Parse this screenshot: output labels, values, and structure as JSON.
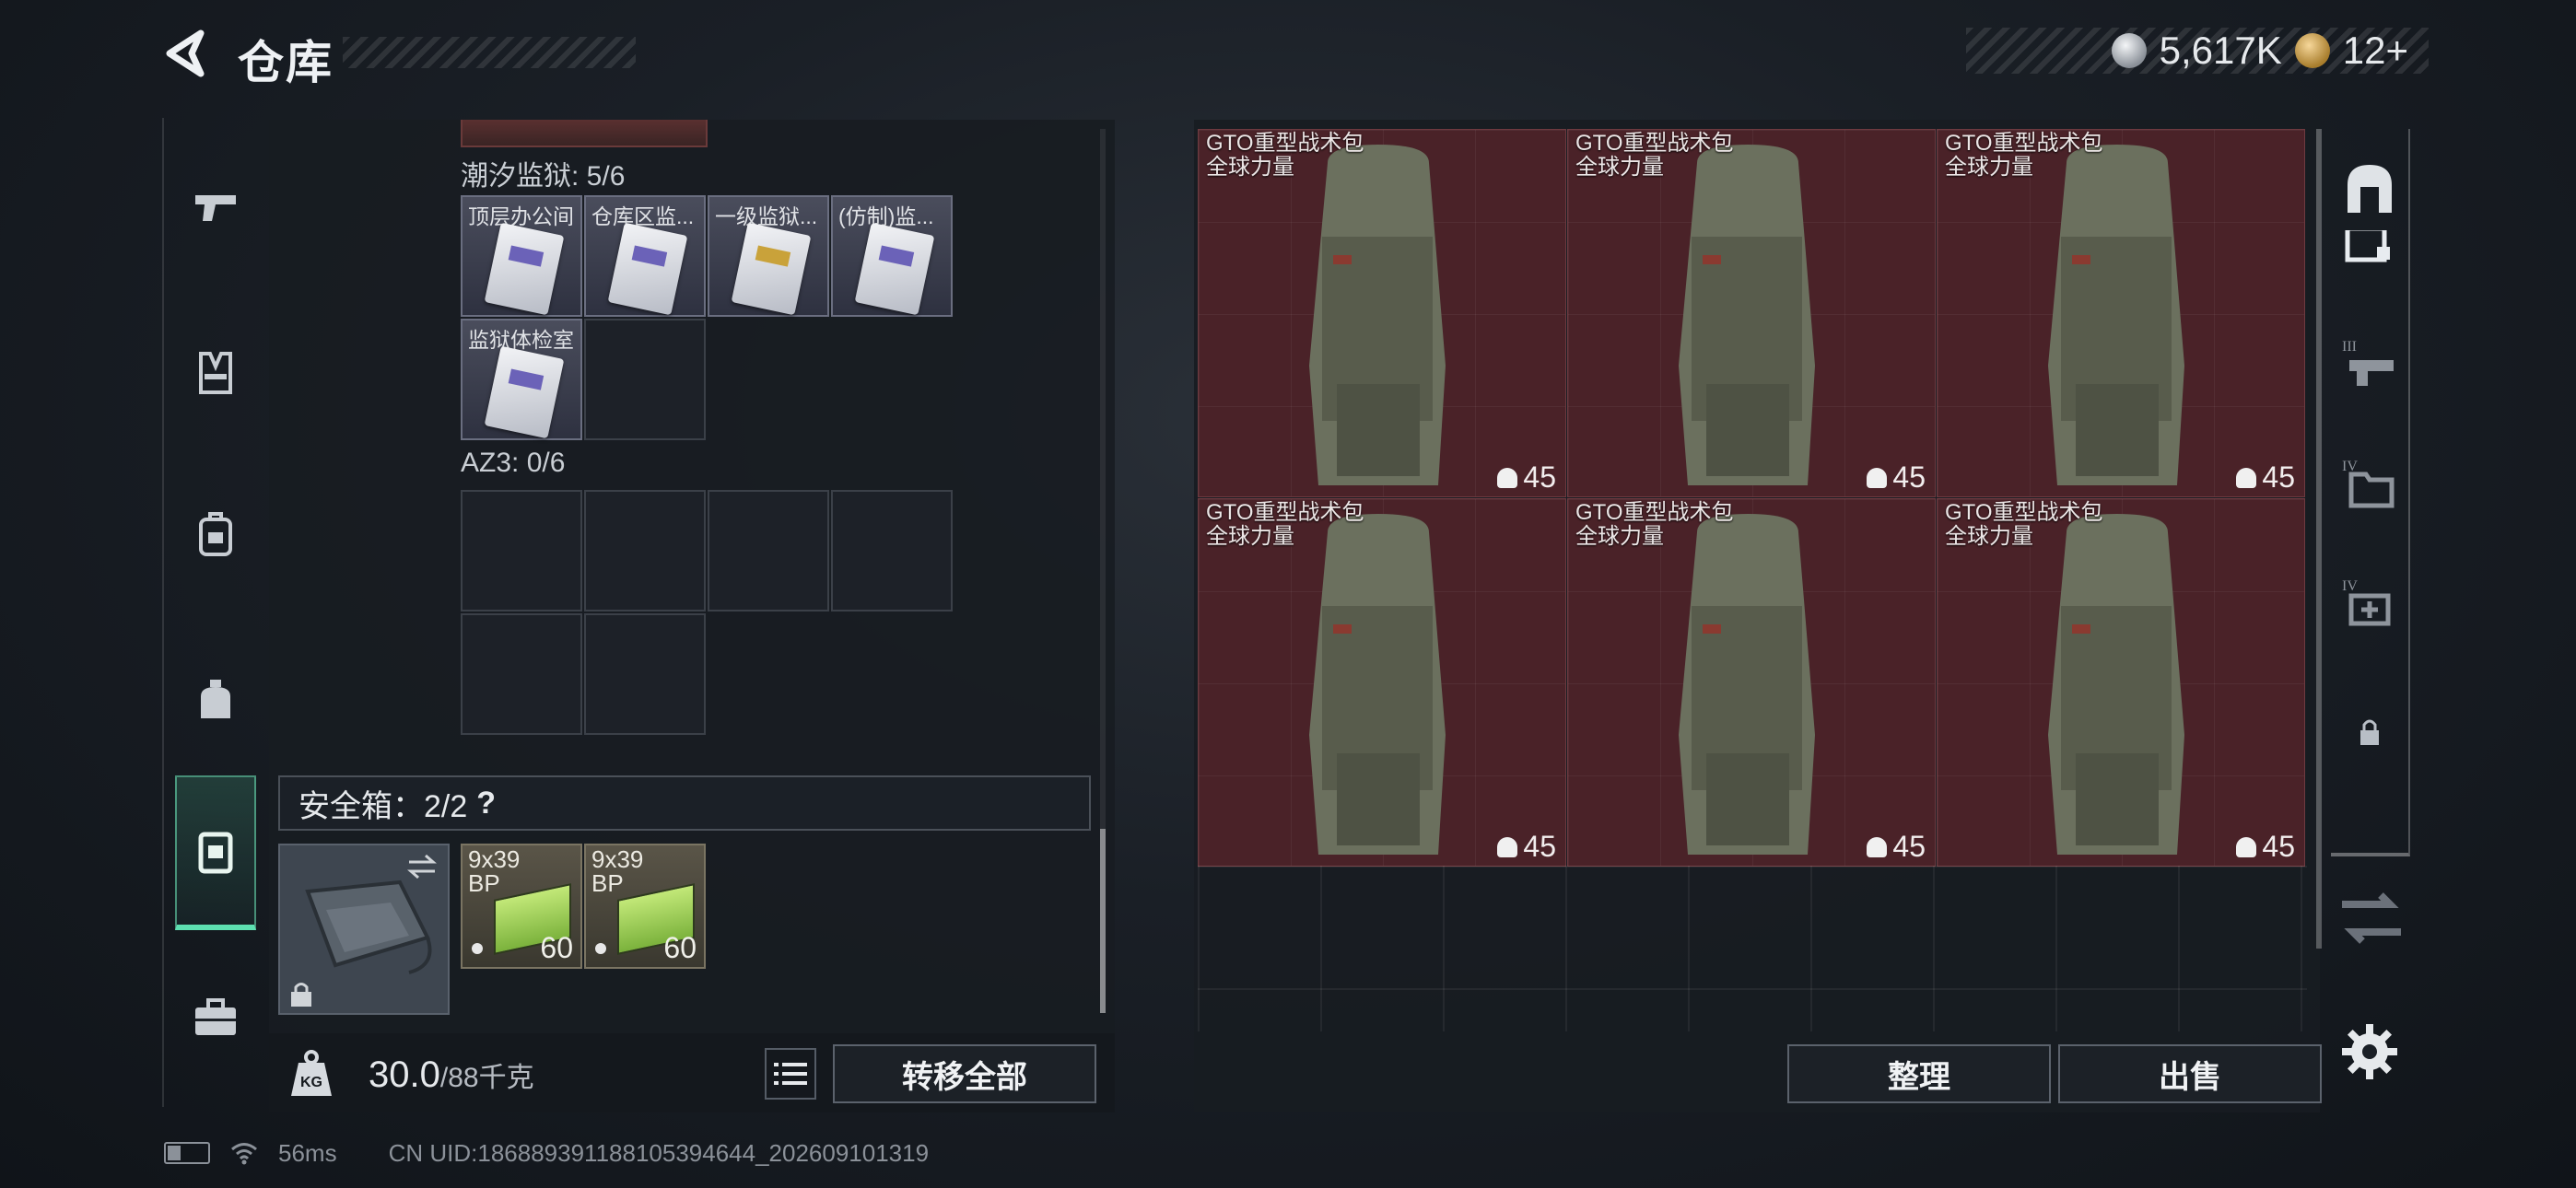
{
  "header": {
    "title": "仓库",
    "currency_silver": "5,617K",
    "currency_gold": "12+"
  },
  "left_panel": {
    "tidal_prison": {
      "title": "潮汐监狱: 5/6",
      "cards": [
        {
          "label": "顶层办公间",
          "variant": "silver"
        },
        {
          "label": "仓库区监...",
          "variant": "silver"
        },
        {
          "label": "一级监狱...",
          "variant": "gold"
        },
        {
          "label": "(仿制)监...",
          "variant": "silver"
        },
        {
          "label": "监狱体检室",
          "variant": "silver"
        }
      ]
    },
    "az3": {
      "title": "AZ3: 0/6"
    },
    "safe_box": {
      "title": "安全箱：2/2",
      "help": "?",
      "ammo": [
        {
          "label": "9x39\nBP",
          "count": "60"
        },
        {
          "label": "9x39\nBP",
          "count": "60"
        }
      ]
    },
    "weight": {
      "value": "30.0",
      "unit": "/88千克"
    },
    "transfer_all_label": "转移全部"
  },
  "right_panel": {
    "items": [
      {
        "name": "GTO重型战术包",
        "sub": "全球力量",
        "durability": "45"
      },
      {
        "name": "GTO重型战术包",
        "sub": "全球力量",
        "durability": "45"
      },
      {
        "name": "GTO重型战术包",
        "sub": "全球力量",
        "durability": "45"
      },
      {
        "name": "GTO重型战术包",
        "sub": "全球力量",
        "durability": "45"
      },
      {
        "name": "GTO重型战术包",
        "sub": "全球力量",
        "durability": "45"
      },
      {
        "name": "GTO重型战术包",
        "sub": "全球力量",
        "durability": "45"
      }
    ],
    "sort_label": "整理",
    "sell_label": "出售"
  },
  "right_nav": {
    "tiers": [
      "III",
      "IV",
      "IV"
    ]
  },
  "status": {
    "ping": "56ms",
    "uid": "CN UID:1868893911881053946​44_202609101319"
  },
  "colors": {
    "accent": "#5de0b0",
    "item_bg": "#4a2228"
  }
}
